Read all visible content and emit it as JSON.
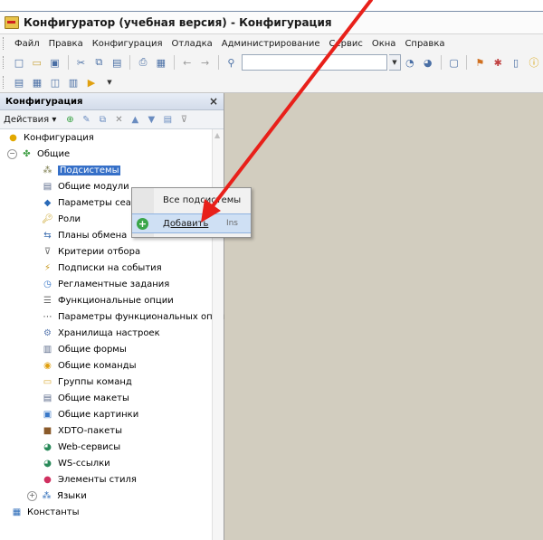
{
  "window": {
    "title": "Конфигуратор (учебная версия) - Конфигурация"
  },
  "menu": [
    "Файл",
    "Правка",
    "Конфигурация",
    "Отладка",
    "Администрирование",
    "Сервис",
    "Окна",
    "Справка"
  ],
  "panel": {
    "title": "Конфигурация",
    "close": "×",
    "actions_label": "Действия ▾"
  },
  "tree": {
    "root": "Конфигурация",
    "group": "Общие",
    "items": [
      "Подсистемы",
      "Общие модули",
      "Параметры сеанса",
      "Роли",
      "Планы обмена",
      "Критерии отбора",
      "Подписки на события",
      "Регламентные задания",
      "Функциональные опции",
      "Параметры функциональных опций",
      "Хранилища настроек",
      "Общие формы",
      "Общие команды",
      "Группы команд",
      "Общие макеты",
      "Общие картинки",
      "XDTO-пакеты",
      "Web-сервисы",
      "WS-ссылки",
      "Элементы стиля"
    ],
    "languages": "Языки",
    "constants": "Константы"
  },
  "context_menu": {
    "all_subsystems": "Все подсистемы",
    "add": "Добавить",
    "add_key": "Ins"
  }
}
